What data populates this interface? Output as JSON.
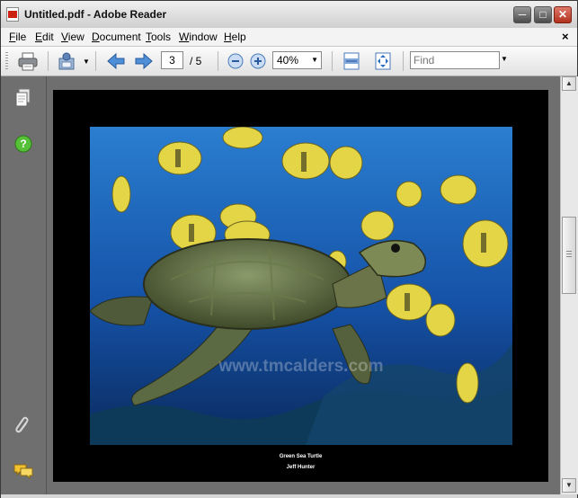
{
  "window": {
    "title": "Untitled.pdf - Adobe Reader"
  },
  "menu": {
    "items": [
      {
        "label": "File",
        "accel": "F",
        "rest": "ile"
      },
      {
        "label": "Edit",
        "accel": "E",
        "rest": "dit"
      },
      {
        "label": "View",
        "accel": "V",
        "rest": "iew"
      },
      {
        "label": "Document",
        "accel": "D",
        "rest": "ocument"
      },
      {
        "label": "Tools",
        "accel": "T",
        "rest": "ools"
      },
      {
        "label": "Window",
        "accel": "W",
        "rest": "indow"
      },
      {
        "label": "Help",
        "accel": "H",
        "rest": "elp"
      }
    ],
    "close_glyph": "×"
  },
  "toolbar": {
    "current_page": "3",
    "page_total": "/ 5",
    "zoom": "40%",
    "find_placeholder": "Find"
  },
  "document": {
    "watermark": "www.tmcalders.com",
    "caption_title": "Green Sea Turtle",
    "caption_author": "Jeff Hunter"
  },
  "icons": {
    "print": "print-icon",
    "email": "email-icon",
    "prev": "previous-page-icon",
    "next": "next-page-icon",
    "zoom_out": "zoom-out-icon",
    "zoom_in": "zoom-in-icon",
    "fit_width": "fit-width-icon",
    "fit_page": "fit-page-icon",
    "pages": "pages-panel-icon",
    "help": "help-icon",
    "attachments": "attachments-icon",
    "comments": "comments-icon"
  },
  "colors": {
    "window_bg": "#6f6f6f",
    "page_bg": "#000000",
    "ocean_top": "#1e6ac2",
    "ocean_bottom": "#0c2f66",
    "fish_yellow": "#e8d84a"
  }
}
